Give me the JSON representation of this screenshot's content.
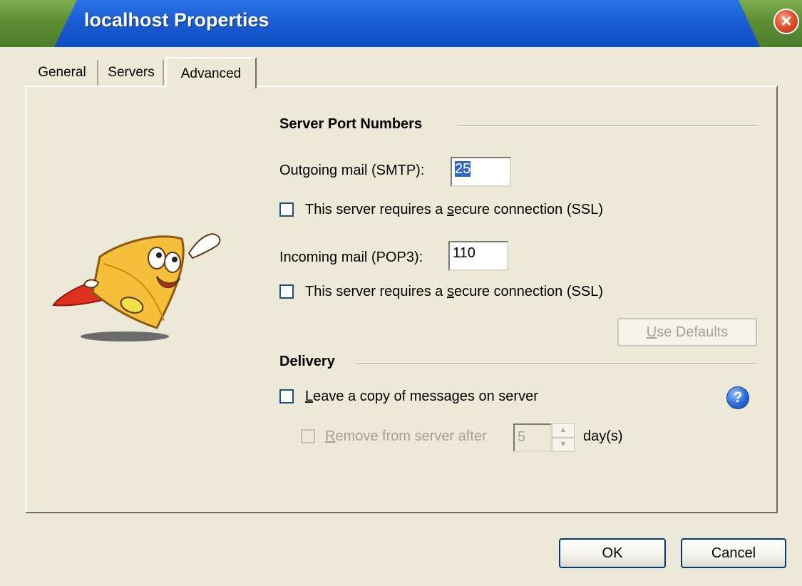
{
  "window": {
    "title": "localhost Properties",
    "close_glyph": "×"
  },
  "tabs": [
    {
      "label": "General",
      "selected": false
    },
    {
      "label": "Servers",
      "selected": false
    },
    {
      "label": "Advanced",
      "selected": true
    }
  ],
  "server_ports": {
    "header": "Server Port Numbers",
    "outgoing": {
      "label": "Outgoing mail (SMTP):",
      "value": "25",
      "ssl_label_pre": "This server requires a ",
      "ssl_label_accel": "s",
      "ssl_label_post": "ecure connection (SSL)",
      "ssl_checked": false
    },
    "incoming": {
      "label": "Incoming mail (POP3):",
      "value": "110",
      "ssl_label_pre": "This server requires a ",
      "ssl_label_accel": "s",
      "ssl_label_post": "ecure connection (SSL)",
      "ssl_checked": false
    },
    "use_defaults": {
      "accel": "U",
      "rest": "se Defaults",
      "enabled": false
    }
  },
  "delivery": {
    "header": "Delivery",
    "leave_copy": {
      "accel": "L",
      "rest": "eave a copy of messages on server",
      "checked": false
    },
    "remove_after": {
      "accel": "R",
      "rest": "emove from server after",
      "value": "5",
      "unit": "day(s)",
      "checked": false,
      "enabled": false
    },
    "help_glyph": "?"
  },
  "footer": {
    "ok_label": "OK",
    "cancel_label": "Cancel"
  },
  "icons": {
    "mascot": "flying-envelope-mascot-icon",
    "help": "help-icon",
    "close": "close-icon"
  },
  "colors": {
    "title_blue": "#1d5fd6",
    "title_green": "#5d8e35",
    "dialog_bg": "#ece9d8",
    "selection": "#316ac5",
    "close_red": "#e0502a"
  }
}
